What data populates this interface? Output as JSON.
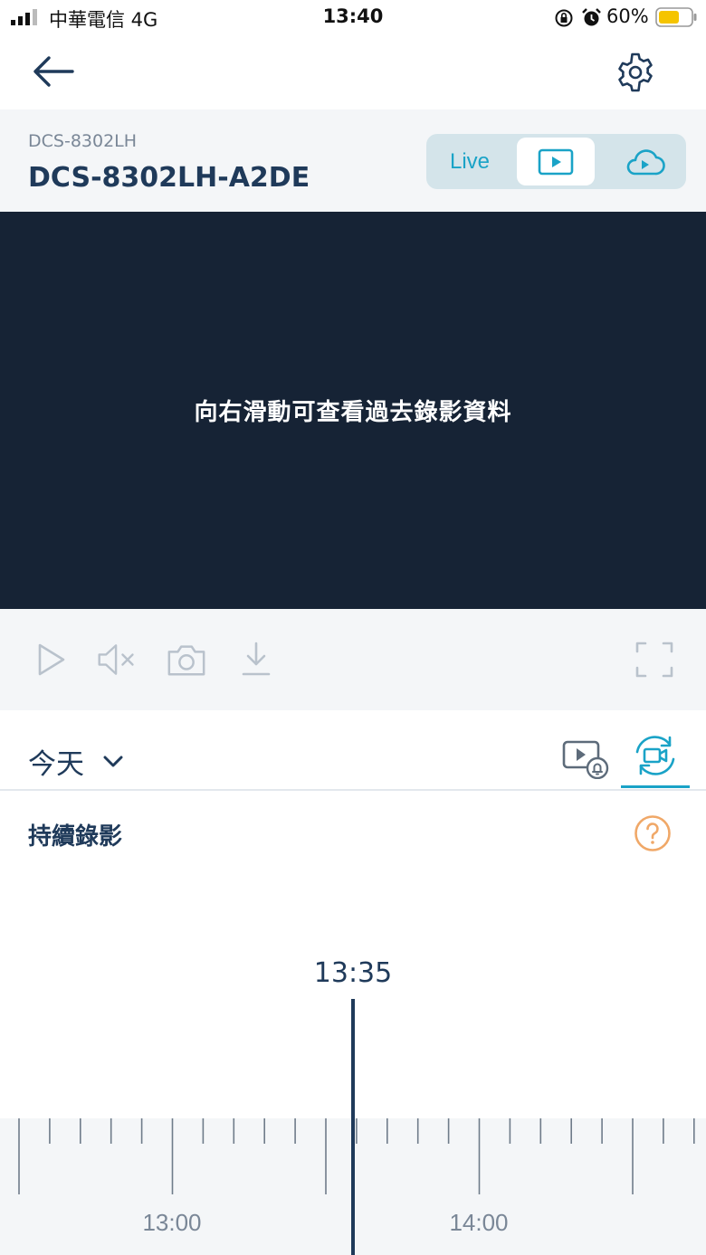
{
  "status_bar": {
    "carrier": "中華電信   4G",
    "time": "13:40",
    "battery": "60%"
  },
  "device": {
    "model": "DCS-8302LH",
    "name": "DCS-8302LH-A2DE"
  },
  "view_switch": {
    "live_label": "Live",
    "selected": "playback"
  },
  "video": {
    "hint": "向右滑動可查看過去錄影資料"
  },
  "date_row": {
    "date_label": "今天"
  },
  "section": {
    "title": "持續錄影"
  },
  "timeline": {
    "current_time": "13:35",
    "labels": [
      "13:00",
      "14:00"
    ]
  },
  "colors": {
    "accent": "#1aa3c7",
    "navy": "#1f3a5a",
    "video_bg": "#162335",
    "help_orange": "#f0a868",
    "battery_yellow": "#f5c400"
  },
  "icons": [
    "back-arrow-icon",
    "gear-icon",
    "play-icon",
    "cloud-play-icon",
    "mute-icon",
    "camera-icon",
    "download-icon",
    "fullscreen-icon",
    "chevron-down-icon",
    "event-video-bell-icon",
    "continuous-record-icon",
    "help-icon"
  ]
}
